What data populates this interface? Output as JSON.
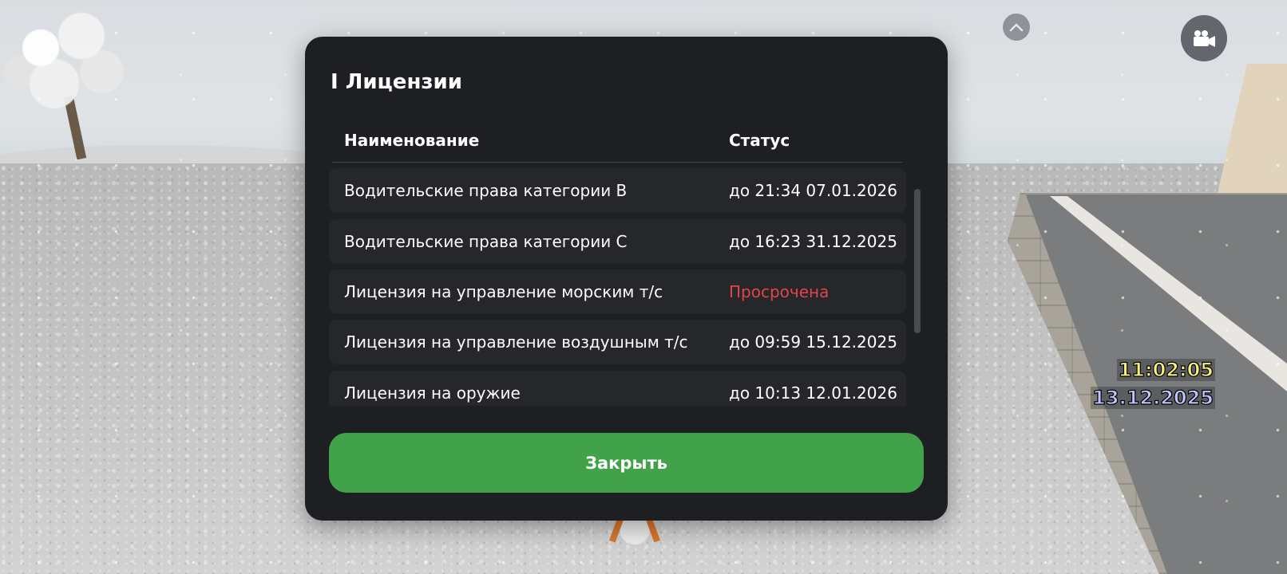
{
  "modal": {
    "title": "I Лицензии",
    "columns": {
      "name": "Наименование",
      "status": "Статус"
    },
    "rows": [
      {
        "name": "Водительские права категории B",
        "status": "до 21:34 07.01.2026",
        "expired": false
      },
      {
        "name": "Водительские права категории C",
        "status": "до 16:23 31.12.2025",
        "expired": false
      },
      {
        "name": "Лицензия на управление морским т/с",
        "status": "Просрочена",
        "expired": true
      },
      {
        "name": "Лицензия на управление воздушным т/с",
        "status": "до 09:59 15.12.2025",
        "expired": false
      },
      {
        "name": "Лицензия на оружие",
        "status": "до 10:13 12.01.2026",
        "expired": false
      }
    ],
    "close_label": "Закрыть"
  },
  "hud": {
    "time": "11:02:05",
    "date": "13.12.2025",
    "icons": [
      "chevron-up-icon",
      "camera-icon"
    ]
  },
  "colors": {
    "modal_bg": "#1e1f23",
    "row_bg": "#26272b",
    "accent_green": "#42a24a",
    "expired_red": "#e0454a",
    "time_yellow": "#f6f27a",
    "date_blue": "#bfc6ff"
  }
}
